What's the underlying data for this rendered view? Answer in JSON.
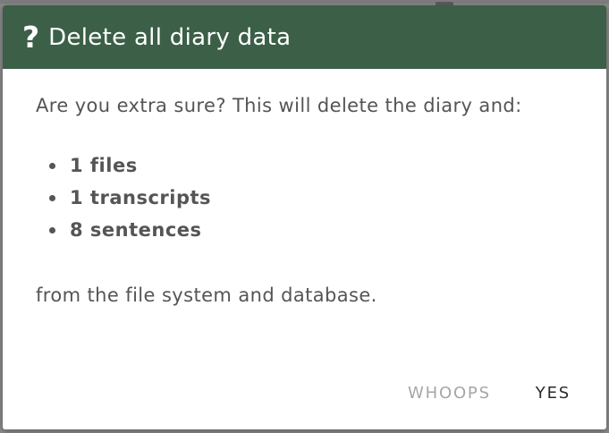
{
  "dialog": {
    "icon": "question-mark-icon",
    "icon_glyph": "?",
    "title": "Delete all diary data",
    "header_color": "#3b5f47",
    "intro": "Are you extra sure? This will delete the diary and:",
    "items": [
      {
        "label": "1 files"
      },
      {
        "label": "1 transcripts"
      },
      {
        "label": "8 sentences"
      }
    ],
    "outro": "from the file system and database.",
    "cancel_label": "WHOOPS",
    "confirm_label": "YES"
  }
}
